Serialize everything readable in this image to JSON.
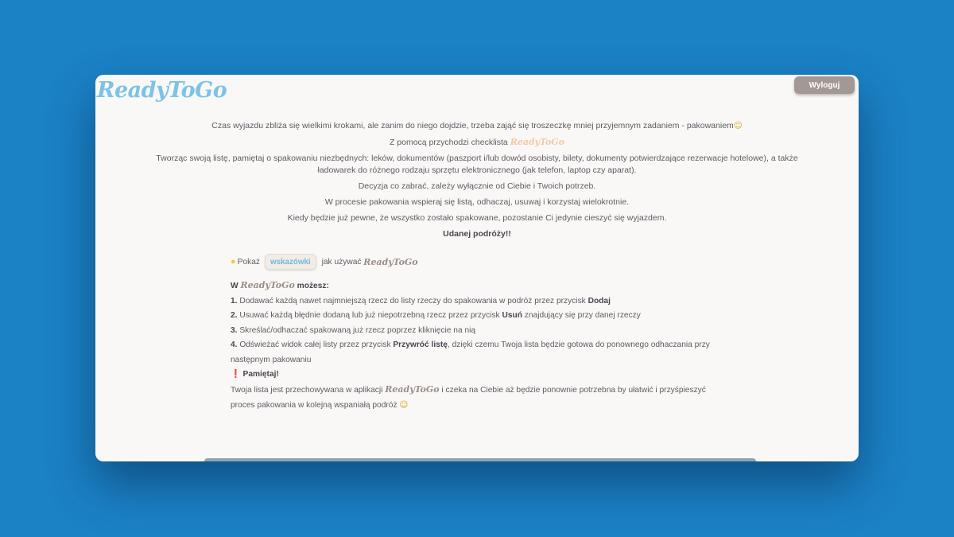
{
  "brand": "ReadyToGo",
  "header": {
    "logout_label": "Wyloguj"
  },
  "intro": {
    "line1": "Czas wyjazdu zbliża się wielkimi krokami, ale zanim do niego dojdzie, trzeba zająć się troszeczkę mniej przyjemnym zadaniem - pakowaniem",
    "line1_emoji": "☺",
    "line2_prefix": "Z pomocą przychodzi checklista",
    "line3": "Tworząc swoją listę, pamiętaj o spakowaniu niezbędnych: leków, dokumentów (paszport i/lub dowód osobisty, bilety, dokumenty potwierdzające rezerwacje hotelowe), a także ładowarek do różnego rodzaju sprzętu elektronicznego (jak telefon, laptop czy aparat).",
    "line4": "Decyzja co zabrać, zależy wyłącznie od Ciebie i Twoich potrzeb.",
    "line5": "W procesie pakowania wspieraj się listą, odhaczaj, usuwaj i korzystaj wielokrotnie.",
    "line6": "Kiedy będzie już pewne, że wszystko zostało spakowane, pozostanie Ci jedynie cieszyć się wyjazdem.",
    "line7": "Udanej podróży!!"
  },
  "hints": {
    "show_prefix": "Pokaż",
    "button_label": "wskazówki",
    "show_suffix": "jak używać",
    "heading_prefix": "W",
    "heading_suffix": "możesz:",
    "items": [
      {
        "num": "1.",
        "pre": " Dodawać każdą nawet najmniejszą rzecz do listy rzeczy do spakowania w podróż przez przycisk ",
        "bold": "Dodaj",
        "post": ""
      },
      {
        "num": "2.",
        "pre": " Usuwać każdą błędnie dodaną lub już niepotrzebną rzecz przez przycisk ",
        "bold": "Usuń",
        "post": " znajdujący się przy danej rzeczy"
      },
      {
        "num": "3.",
        "pre": " Skreślać/odhaczać spakowaną już rzecz poprzez kliknięcie na nią",
        "bold": "",
        "post": ""
      },
      {
        "num": "4.",
        "pre": " Odświeżać widok całej listy przez przycisk ",
        "bold": "Przywróć listę",
        "post": ", dzięki czemu Twoja lista będzie gotowa do ponownego odhaczania przy następnym pakowaniu"
      }
    ],
    "remember_mark": "❗",
    "remember_label": "Pamiętaj!",
    "note_prefix": "Twoja lista jest przechowywana w aplikacji",
    "note_suffix": "i czeka na Ciebie aż będzie ponownie potrzebna by ułatwić i przyśpieszyć proces pakowania w kolejną wspaniałą podróż",
    "note_emoji": "☺"
  }
}
